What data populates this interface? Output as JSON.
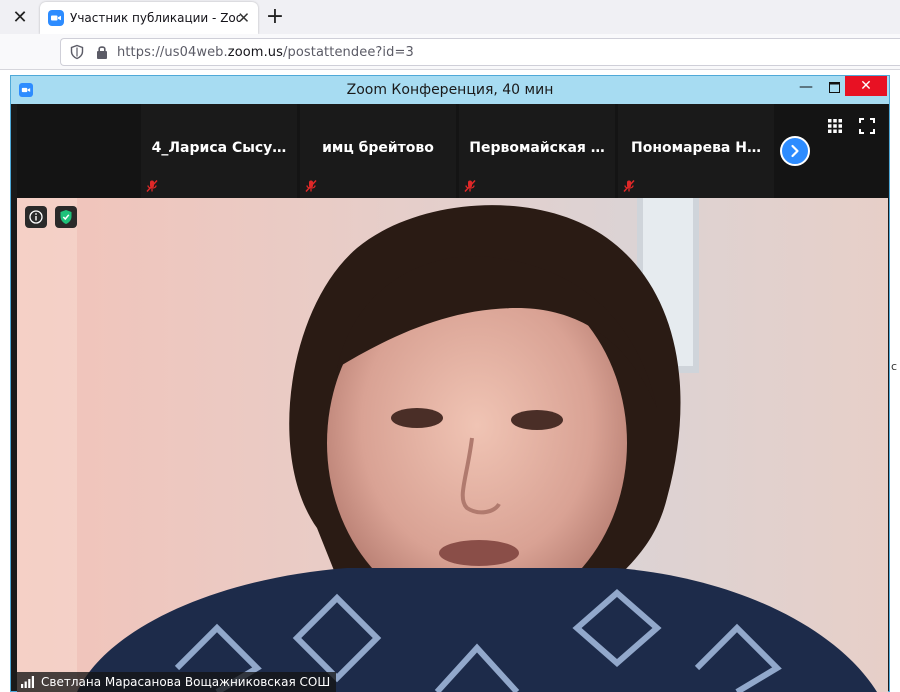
{
  "browser": {
    "tab_title": "Участник публикации - Zoom",
    "url_prefix": "https://us04web.",
    "url_domain": "zoom.us",
    "url_path": "/postattendee?id=3"
  },
  "zoom": {
    "window_title": "Zoom Конференция, 40 мин",
    "accent_color": "#2d8cff",
    "participants": [
      {
        "name": "4_Лариса  Сысу…",
        "muted": true
      },
      {
        "name": "имц брейтово",
        "muted": true
      },
      {
        "name": "Первомайская …",
        "muted": true
      },
      {
        "name": "Пономарева  Н…",
        "muted": true
      }
    ],
    "active_speaker": "Светлана Марасанова Вощажниковская СОШ",
    "icons": {
      "next": "chevron-right-icon",
      "gallery": "grid-icon",
      "fullscreen": "fullscreen-icon",
      "info": "info-icon",
      "security": "shield-check-icon"
    }
  },
  "page": {
    "side_fragment": "с"
  }
}
